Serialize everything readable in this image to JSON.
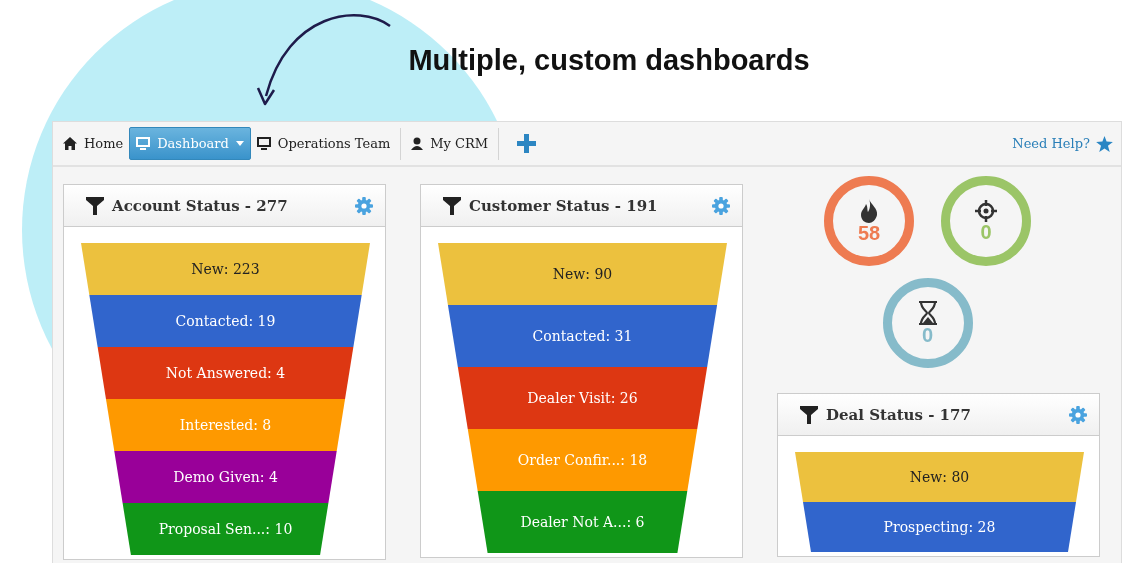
{
  "heading": "Multiple, custom dashboards",
  "nav": {
    "tabs": [
      {
        "label": "Home",
        "kind": "home",
        "selected": false,
        "dropdown": false
      },
      {
        "label": "Dashboard",
        "kind": "monitor",
        "selected": true,
        "dropdown": true
      },
      {
        "label": "Operations Team",
        "kind": "monitor",
        "selected": false,
        "dropdown": false
      },
      {
        "label": "My CRM",
        "kind": "person",
        "selected": false,
        "dropdown": false
      }
    ],
    "help_link": "Need Help?"
  },
  "dashboards": [
    {
      "title": "Account Status - 277",
      "stages": [
        {
          "label": "New: 223",
          "color": "#ecc13e"
        },
        {
          "label": "Contacted: 19",
          "color": "#3165cc"
        },
        {
          "label": "Not Answered: 4",
          "color": "#dd3712"
        },
        {
          "label": "Interested: 8",
          "color": "#fe9900"
        },
        {
          "label": "Demo Given: 4",
          "color": "#990099"
        },
        {
          "label": "Proposal Sen...: 10",
          "color": "#109618"
        }
      ]
    },
    {
      "title": "Customer Status - 191",
      "stages": [
        {
          "label": "New: 90",
          "color": "#ecc13e"
        },
        {
          "label": "Contacted: 31",
          "color": "#3165cc"
        },
        {
          "label": "Dealer Visit: 26",
          "color": "#dd3712"
        },
        {
          "label": "Order Confir...: 18",
          "color": "#fe9900"
        },
        {
          "label": "Dealer Not A...: 6",
          "color": "#109618"
        }
      ]
    },
    {
      "title": "Deal Status - 177",
      "stages": [
        {
          "label": "New: 80",
          "color": "#ecc13e"
        },
        {
          "label": "Prospecting: 28",
          "color": "#3165cc"
        }
      ]
    }
  ],
  "indicators": [
    {
      "kind": "fire",
      "value": "58",
      "color": "#ee7b51"
    },
    {
      "kind": "target",
      "value": "0",
      "color": "#9bc567"
    },
    {
      "kind": "hourglass",
      "value": "0",
      "color": "#86bbca"
    }
  ]
}
